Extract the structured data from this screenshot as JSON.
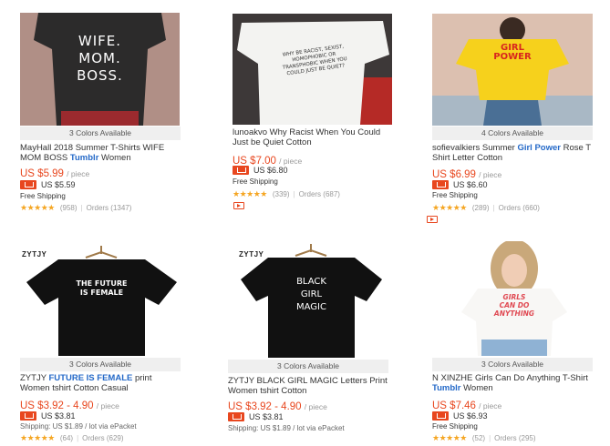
{
  "products": [
    {
      "colors": "3 Colors Available",
      "title_pre": "MayHall 2018 Summer T-Shirts WIFE MOM BOSS ",
      "title_bold": "Tumblr",
      "title_post": " Women",
      "price": "US $5.99",
      "unit": "/ piece",
      "app_price": "US $5.59",
      "shipping": "Free Shipping",
      "reviews": "(958)",
      "orders": "Orders (1347)",
      "stars": "★★★★★",
      "shirt_text": "WIFE.\nMOM.\nBOSS."
    },
    {
      "colors": "",
      "title_pre": "lunoakvo Why Racist When You Could Just be Quiet Cotton",
      "title_bold": "",
      "title_post": "",
      "price": "US $7.00",
      "unit": "/ piece",
      "app_price": "US $6.80",
      "shipping": "Free Shipping",
      "reviews": "(339)",
      "orders": "Orders (687)",
      "stars": "★★★★★",
      "shirt_text": "WHY BE RACIST, SEXIST, HOMOPHOBIC OR TRANSPHOBIC WHEN YOU COULD JUST BE QUIET?"
    },
    {
      "colors": "4 Colors Available",
      "title_pre": "sofievalkiers Summer ",
      "title_bold": "Girl Power",
      "title_post": " Rose T Shirt Letter Cotton",
      "price": "US $6.99",
      "unit": "/ piece",
      "app_price": "US $6.60",
      "shipping": "Free Shipping",
      "reviews": "(289)",
      "orders": "Orders (660)",
      "stars": "★★★★★",
      "shirt_text": "GIRL\nPOWER"
    },
    {
      "colors": "3 Colors Available",
      "title_pre": "ZYTJY ",
      "title_bold": "FUTURE IS FEMALE",
      "title_post": " print Women tshirt Cotton Casual",
      "price": "US $3.92 - 4.90",
      "unit": "/ piece",
      "app_price": "US $3.81",
      "shipping": "Shipping: US $1.89 / lot via ePacket",
      "reviews": "(64)",
      "orders": "Orders (629)",
      "stars": "★★★★★",
      "brand": "ZYTJY",
      "shirt_text": "THE FUTURE\nIS FEMALE"
    },
    {
      "colors": "3 Colors Available",
      "title_pre": "ZYTJY BLACK GIRL MAGIC Letters Print Women tshirt Cotton",
      "title_bold": "",
      "title_post": "",
      "price": "US $3.92 - 4.90",
      "unit": "/ piece",
      "app_price": "US $3.81",
      "shipping": "Shipping: US $1.89 / lot via ePacket",
      "reviews": "",
      "orders": "",
      "stars": "",
      "brand": "ZYTJY",
      "shirt_text": "BLACK\nGIRL\nMAGIC"
    },
    {
      "colors": "3 Colors Available",
      "title_pre": "N XINZHE Girls Can Do Anything T-Shirt ",
      "title_bold": "Tumblr",
      "title_post": " Women",
      "price": "US $7.46",
      "unit": "/ piece",
      "app_price": "US $6.93",
      "shipping": "Free Shipping",
      "reviews": "(52)",
      "orders": "Orders (295)",
      "stars": "★★★★★",
      "shirt_text": "GIRLS\nCAN DO\nANYTHING"
    }
  ],
  "colors": {
    "price": "#e8471f",
    "link_bold": "#2469c8",
    "star": "#f5a623"
  }
}
